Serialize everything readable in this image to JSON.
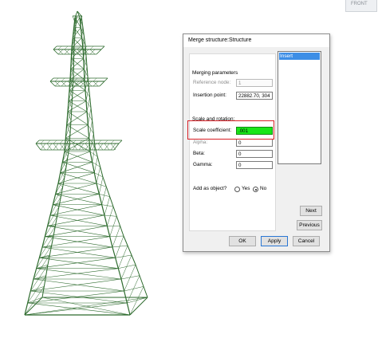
{
  "viewcube": {
    "label": "FRONT"
  },
  "dialog": {
    "title": "Merge structure:Structure",
    "merging_parameters": {
      "heading": "Merging parameters",
      "reference_node_label": "Reference node:",
      "reference_node_value": "1",
      "insertion_point_label": "Insertion point:",
      "insertion_point_value": "22882.70, 304"
    },
    "scale_rotation": {
      "heading": "Scale and rotation:",
      "scale_label": "Scale coefficient:",
      "scale_value": ".001",
      "alpha_label": "Alpha:",
      "alpha_value": "0",
      "beta_label": "Beta:",
      "beta_value": "0",
      "gamma_label": "Gamma:",
      "gamma_value": "0"
    },
    "add_as_object": {
      "label": "Add as object?",
      "yes_label": "Yes",
      "no_label": "No",
      "selected": "No"
    },
    "list": {
      "items": [
        "Insert"
      ],
      "selected_index": 0
    },
    "buttons": {
      "next": "Next",
      "previous": "Previous",
      "ok": "OK",
      "apply": "Apply",
      "cancel": "Cancel"
    }
  },
  "colors": {
    "tower": "#2c6a2c",
    "highlight": "#d81f26",
    "scale_field": "#19e619",
    "selection": "#3d8ee6"
  }
}
